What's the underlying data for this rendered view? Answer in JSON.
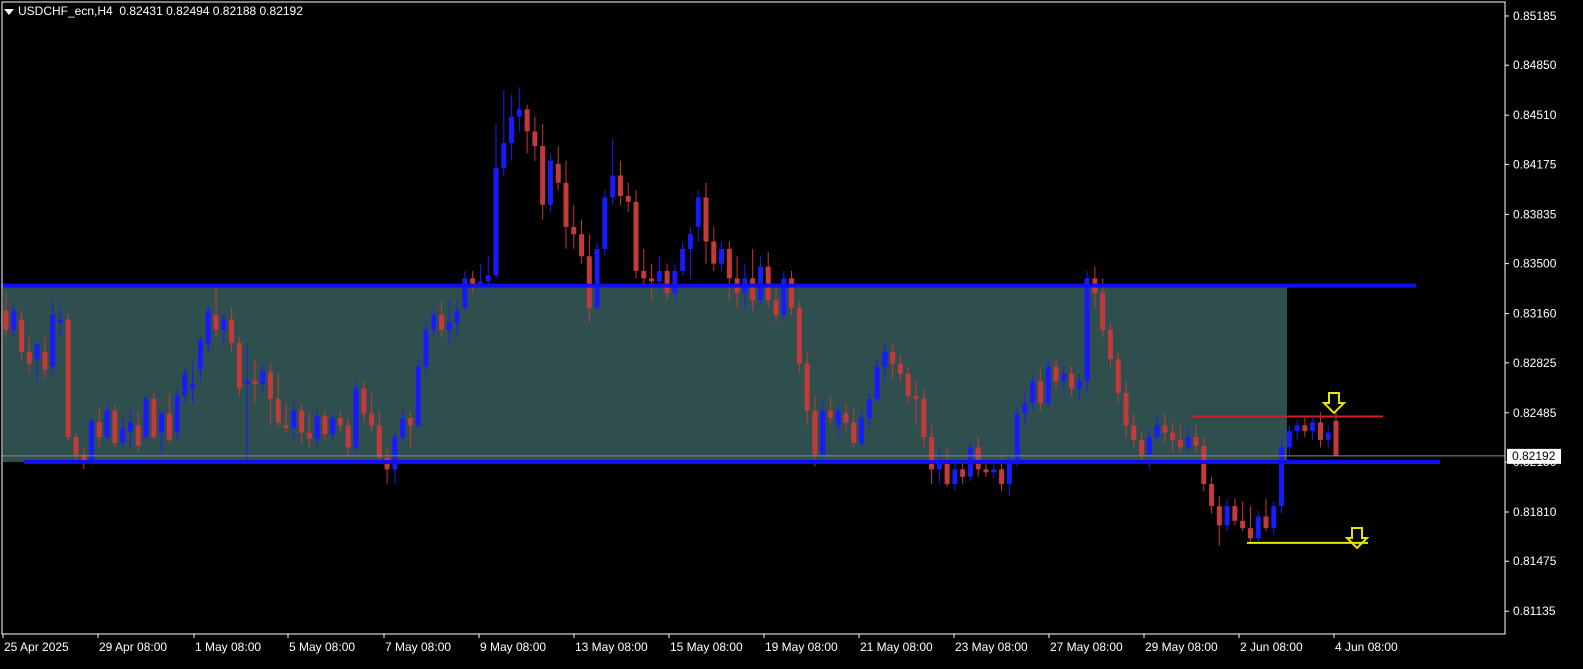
{
  "header": {
    "symbol": "USDCHF_ecn,H4",
    "ohlc": "0.82431 0.82494 0.82188 0.82192"
  },
  "colors": {
    "background": "#000000",
    "bull": "#1a1aff",
    "bear": "#c23a3a",
    "zone": "#2f4f4f",
    "zone_line": "#1010ee",
    "resistance_line": "#cc2222",
    "support_line": "#e6e600",
    "arrow": "#e6e600",
    "current_price_line": "#8a8a8a"
  },
  "icons": [
    "arrow-down-icon",
    "arrow-down-icon"
  ],
  "chart_data": {
    "type": "candlestick",
    "ylim": [
      0.8098,
      0.8528
    ],
    "y_ticks": [
      "0.85185",
      "0.84850",
      "0.84510",
      "0.84175",
      "0.83835",
      "0.83500",
      "0.83160",
      "0.82825",
      "0.82485",
      "0.82150",
      "0.81810",
      "0.81475",
      "0.81135"
    ],
    "x_ticks": [
      "25 Apr 2025",
      "29 Apr 08:00",
      "1 May 08:00",
      "5 May 08:00",
      "7 May 08:00",
      "9 May 08:00",
      "13 May 08:00",
      "15 May 08:00",
      "19 May 08:00",
      "21 May 08:00",
      "23 May 08:00",
      "27 May 08:00",
      "29 May 08:00",
      "2 Jun 08:00",
      "4 Jun 08:00"
    ],
    "current_price": "0.82192",
    "zone": {
      "top": 0.8335,
      "bottom": 0.8215
    },
    "resistance": 0.8246,
    "support": 0.816,
    "candles": [
      {
        "o": 0.8318,
        "h": 0.833,
        "l": 0.83,
        "c": 0.8305
      },
      {
        "o": 0.8305,
        "h": 0.8322,
        "l": 0.83,
        "c": 0.8318
      },
      {
        "o": 0.8312,
        "h": 0.8318,
        "l": 0.8285,
        "c": 0.829
      },
      {
        "o": 0.829,
        "h": 0.83,
        "l": 0.8275,
        "c": 0.8282
      },
      {
        "o": 0.8285,
        "h": 0.8298,
        "l": 0.827,
        "c": 0.8295
      },
      {
        "o": 0.829,
        "h": 0.83,
        "l": 0.8272,
        "c": 0.8278
      },
      {
        "o": 0.828,
        "h": 0.8325,
        "l": 0.8275,
        "c": 0.8315
      },
      {
        "o": 0.831,
        "h": 0.832,
        "l": 0.83,
        "c": 0.8312
      },
      {
        "o": 0.8312,
        "h": 0.8316,
        "l": 0.823,
        "c": 0.8232
      },
      {
        "o": 0.8232,
        "h": 0.8235,
        "l": 0.8215,
        "c": 0.822
      },
      {
        "o": 0.822,
        "h": 0.8225,
        "l": 0.821,
        "c": 0.8215
      },
      {
        "o": 0.8215,
        "h": 0.8245,
        "l": 0.8213,
        "c": 0.8243
      },
      {
        "o": 0.8242,
        "h": 0.8252,
        "l": 0.8225,
        "c": 0.8232
      },
      {
        "o": 0.8232,
        "h": 0.8255,
        "l": 0.8228,
        "c": 0.825
      },
      {
        "o": 0.825,
        "h": 0.8254,
        "l": 0.8225,
        "c": 0.8228
      },
      {
        "o": 0.8228,
        "h": 0.8245,
        "l": 0.8224,
        "c": 0.8238
      },
      {
        "o": 0.8236,
        "h": 0.825,
        "l": 0.8225,
        "c": 0.8242
      },
      {
        "o": 0.824,
        "h": 0.825,
        "l": 0.8222,
        "c": 0.8226
      },
      {
        "o": 0.8232,
        "h": 0.826,
        "l": 0.823,
        "c": 0.8258
      },
      {
        "o": 0.8258,
        "h": 0.8262,
        "l": 0.823,
        "c": 0.8232
      },
      {
        "o": 0.8235,
        "h": 0.825,
        "l": 0.8222,
        "c": 0.8248
      },
      {
        "o": 0.8248,
        "h": 0.8262,
        "l": 0.8228,
        "c": 0.823
      },
      {
        "o": 0.8235,
        "h": 0.8265,
        "l": 0.823,
        "c": 0.826
      },
      {
        "o": 0.826,
        "h": 0.828,
        "l": 0.8255,
        "c": 0.8275
      },
      {
        "o": 0.8265,
        "h": 0.8284,
        "l": 0.8255,
        "c": 0.8268
      },
      {
        "o": 0.8278,
        "h": 0.83,
        "l": 0.827,
        "c": 0.8298
      },
      {
        "o": 0.8295,
        "h": 0.8322,
        "l": 0.829,
        "c": 0.8318
      },
      {
        "o": 0.8315,
        "h": 0.8335,
        "l": 0.83,
        "c": 0.8305
      },
      {
        "o": 0.8305,
        "h": 0.8316,
        "l": 0.8295,
        "c": 0.8312
      },
      {
        "o": 0.8312,
        "h": 0.832,
        "l": 0.829,
        "c": 0.8296
      },
      {
        "o": 0.8296,
        "h": 0.83,
        "l": 0.826,
        "c": 0.8265
      },
      {
        "o": 0.8268,
        "h": 0.8294,
        "l": 0.8215,
        "c": 0.827
      },
      {
        "o": 0.827,
        "h": 0.8285,
        "l": 0.8255,
        "c": 0.8268
      },
      {
        "o": 0.8268,
        "h": 0.8282,
        "l": 0.8262,
        "c": 0.8277
      },
      {
        "o": 0.8276,
        "h": 0.8282,
        "l": 0.824,
        "c": 0.8258
      },
      {
        "o": 0.8258,
        "h": 0.8275,
        "l": 0.8238,
        "c": 0.8242
      },
      {
        "o": 0.824,
        "h": 0.8255,
        "l": 0.8235,
        "c": 0.8238
      },
      {
        "o": 0.8238,
        "h": 0.8256,
        "l": 0.823,
        "c": 0.825
      },
      {
        "o": 0.825,
        "h": 0.8255,
        "l": 0.8228,
        "c": 0.8235
      },
      {
        "o": 0.8235,
        "h": 0.8248,
        "l": 0.8225,
        "c": 0.8231
      },
      {
        "o": 0.8231,
        "h": 0.825,
        "l": 0.8226,
        "c": 0.8246
      },
      {
        "o": 0.8246,
        "h": 0.825,
        "l": 0.823,
        "c": 0.8234
      },
      {
        "o": 0.8234,
        "h": 0.8248,
        "l": 0.823,
        "c": 0.8245
      },
      {
        "o": 0.8245,
        "h": 0.825,
        "l": 0.8235,
        "c": 0.824
      },
      {
        "o": 0.824,
        "h": 0.8245,
        "l": 0.822,
        "c": 0.8225
      },
      {
        "o": 0.8225,
        "h": 0.827,
        "l": 0.8222,
        "c": 0.8265
      },
      {
        "o": 0.8265,
        "h": 0.827,
        "l": 0.8242,
        "c": 0.8248
      },
      {
        "o": 0.8248,
        "h": 0.8262,
        "l": 0.8235,
        "c": 0.824
      },
      {
        "o": 0.824,
        "h": 0.825,
        "l": 0.8215,
        "c": 0.8218
      },
      {
        "o": 0.8218,
        "h": 0.8225,
        "l": 0.82,
        "c": 0.821
      },
      {
        "o": 0.821,
        "h": 0.8235,
        "l": 0.82,
        "c": 0.8232
      },
      {
        "o": 0.8232,
        "h": 0.825,
        "l": 0.8228,
        "c": 0.8245
      },
      {
        "o": 0.8245,
        "h": 0.825,
        "l": 0.8225,
        "c": 0.824
      },
      {
        "o": 0.824,
        "h": 0.8285,
        "l": 0.8238,
        "c": 0.828
      },
      {
        "o": 0.828,
        "h": 0.831,
        "l": 0.8275,
        "c": 0.8305
      },
      {
        "o": 0.8305,
        "h": 0.832,
        "l": 0.83,
        "c": 0.8315
      },
      {
        "o": 0.8315,
        "h": 0.8325,
        "l": 0.83,
        "c": 0.8305
      },
      {
        "o": 0.8305,
        "h": 0.8325,
        "l": 0.8295,
        "c": 0.831
      },
      {
        "o": 0.831,
        "h": 0.8325,
        "l": 0.83,
        "c": 0.8318
      },
      {
        "o": 0.832,
        "h": 0.8345,
        "l": 0.8318,
        "c": 0.834
      },
      {
        "o": 0.834,
        "h": 0.8345,
        "l": 0.833,
        "c": 0.8335
      },
      {
        "o": 0.8335,
        "h": 0.835,
        "l": 0.8332,
        "c": 0.8338
      },
      {
        "o": 0.8338,
        "h": 0.8355,
        "l": 0.8335,
        "c": 0.8342
      },
      {
        "o": 0.8342,
        "h": 0.8445,
        "l": 0.834,
        "c": 0.8415
      },
      {
        "o": 0.8415,
        "h": 0.8468,
        "l": 0.841,
        "c": 0.8432
      },
      {
        "o": 0.8432,
        "h": 0.8465,
        "l": 0.842,
        "c": 0.845
      },
      {
        "o": 0.845,
        "h": 0.847,
        "l": 0.844,
        "c": 0.8455
      },
      {
        "o": 0.8455,
        "h": 0.8458,
        "l": 0.8425,
        "c": 0.844
      },
      {
        "o": 0.844,
        "h": 0.845,
        "l": 0.842,
        "c": 0.843
      },
      {
        "o": 0.843,
        "h": 0.8445,
        "l": 0.838,
        "c": 0.839
      },
      {
        "o": 0.839,
        "h": 0.8425,
        "l": 0.8385,
        "c": 0.842
      },
      {
        "o": 0.8418,
        "h": 0.843,
        "l": 0.84,
        "c": 0.8405
      },
      {
        "o": 0.8405,
        "h": 0.842,
        "l": 0.836,
        "c": 0.8375
      },
      {
        "o": 0.8375,
        "h": 0.839,
        "l": 0.836,
        "c": 0.837
      },
      {
        "o": 0.837,
        "h": 0.838,
        "l": 0.835,
        "c": 0.8355
      },
      {
        "o": 0.8355,
        "h": 0.837,
        "l": 0.831,
        "c": 0.832
      },
      {
        "o": 0.832,
        "h": 0.8365,
        "l": 0.8318,
        "c": 0.836
      },
      {
        "o": 0.836,
        "h": 0.84,
        "l": 0.8355,
        "c": 0.8395
      },
      {
        "o": 0.8395,
        "h": 0.8435,
        "l": 0.839,
        "c": 0.841
      },
      {
        "o": 0.841,
        "h": 0.842,
        "l": 0.839,
        "c": 0.8396
      },
      {
        "o": 0.8396,
        "h": 0.8405,
        "l": 0.8385,
        "c": 0.8392
      },
      {
        "o": 0.8392,
        "h": 0.84,
        "l": 0.834,
        "c": 0.8345
      },
      {
        "o": 0.8345,
        "h": 0.836,
        "l": 0.8335,
        "c": 0.834
      },
      {
        "o": 0.834,
        "h": 0.835,
        "l": 0.8325,
        "c": 0.8338
      },
      {
        "o": 0.8338,
        "h": 0.8355,
        "l": 0.833,
        "c": 0.8345
      },
      {
        "o": 0.8345,
        "h": 0.835,
        "l": 0.8325,
        "c": 0.833
      },
      {
        "o": 0.833,
        "h": 0.835,
        "l": 0.8325,
        "c": 0.8345
      },
      {
        "o": 0.8345,
        "h": 0.8365,
        "l": 0.8342,
        "c": 0.836
      },
      {
        "o": 0.836,
        "h": 0.8375,
        "l": 0.834,
        "c": 0.837
      },
      {
        "o": 0.8375,
        "h": 0.84,
        "l": 0.8365,
        "c": 0.8395
      },
      {
        "o": 0.8395,
        "h": 0.8405,
        "l": 0.835,
        "c": 0.8365
      },
      {
        "o": 0.8365,
        "h": 0.8375,
        "l": 0.8345,
        "c": 0.835
      },
      {
        "o": 0.835,
        "h": 0.8365,
        "l": 0.8345,
        "c": 0.836
      },
      {
        "o": 0.836,
        "h": 0.8365,
        "l": 0.8325,
        "c": 0.834
      },
      {
        "o": 0.834,
        "h": 0.8355,
        "l": 0.832,
        "c": 0.833
      },
      {
        "o": 0.833,
        "h": 0.835,
        "l": 0.832,
        "c": 0.834
      },
      {
        "o": 0.834,
        "h": 0.836,
        "l": 0.8318,
        "c": 0.8325
      },
      {
        "o": 0.8325,
        "h": 0.8355,
        "l": 0.8322,
        "c": 0.8348
      },
      {
        "o": 0.8348,
        "h": 0.8358,
        "l": 0.832,
        "c": 0.8325
      },
      {
        "o": 0.8325,
        "h": 0.8335,
        "l": 0.831,
        "c": 0.8315
      },
      {
        "o": 0.8315,
        "h": 0.8345,
        "l": 0.8312,
        "c": 0.834
      },
      {
        "o": 0.834,
        "h": 0.8345,
        "l": 0.8315,
        "c": 0.832
      },
      {
        "o": 0.832,
        "h": 0.8325,
        "l": 0.8275,
        "c": 0.8282
      },
      {
        "o": 0.8282,
        "h": 0.829,
        "l": 0.824,
        "c": 0.825
      },
      {
        "o": 0.825,
        "h": 0.826,
        "l": 0.8212,
        "c": 0.822
      },
      {
        "o": 0.822,
        "h": 0.8258,
        "l": 0.8218,
        "c": 0.825
      },
      {
        "o": 0.825,
        "h": 0.826,
        "l": 0.824,
        "c": 0.8245
      },
      {
        "o": 0.824,
        "h": 0.8255,
        "l": 0.8232,
        "c": 0.825
      },
      {
        "o": 0.8248,
        "h": 0.8255,
        "l": 0.8235,
        "c": 0.8242
      },
      {
        "o": 0.8242,
        "h": 0.8252,
        "l": 0.8225,
        "c": 0.8228
      },
      {
        "o": 0.8228,
        "h": 0.825,
        "l": 0.8225,
        "c": 0.8245
      },
      {
        "o": 0.8245,
        "h": 0.8262,
        "l": 0.8238,
        "c": 0.8258
      },
      {
        "o": 0.8258,
        "h": 0.8285,
        "l": 0.8255,
        "c": 0.828
      },
      {
        "o": 0.828,
        "h": 0.8295,
        "l": 0.827,
        "c": 0.829
      },
      {
        "o": 0.829,
        "h": 0.8295,
        "l": 0.8272,
        "c": 0.8282
      },
      {
        "o": 0.8282,
        "h": 0.8288,
        "l": 0.827,
        "c": 0.8275
      },
      {
        "o": 0.8275,
        "h": 0.828,
        "l": 0.8255,
        "c": 0.826
      },
      {
        "o": 0.826,
        "h": 0.827,
        "l": 0.824,
        "c": 0.8258
      },
      {
        "o": 0.8258,
        "h": 0.8265,
        "l": 0.8225,
        "c": 0.8232
      },
      {
        "o": 0.8232,
        "h": 0.824,
        "l": 0.82,
        "c": 0.821
      },
      {
        "o": 0.821,
        "h": 0.8225,
        "l": 0.82,
        "c": 0.8215
      },
      {
        "o": 0.8215,
        "h": 0.8225,
        "l": 0.8198,
        "c": 0.82
      },
      {
        "o": 0.82,
        "h": 0.8215,
        "l": 0.8196,
        "c": 0.821
      },
      {
        "o": 0.821,
        "h": 0.8218,
        "l": 0.82,
        "c": 0.8205
      },
      {
        "o": 0.8205,
        "h": 0.8228,
        "l": 0.8202,
        "c": 0.8225
      },
      {
        "o": 0.8225,
        "h": 0.8232,
        "l": 0.8205,
        "c": 0.821
      },
      {
        "o": 0.821,
        "h": 0.8215,
        "l": 0.8205,
        "c": 0.8208
      },
      {
        "o": 0.8208,
        "h": 0.8215,
        "l": 0.8204,
        "c": 0.821
      },
      {
        "o": 0.821,
        "h": 0.822,
        "l": 0.8195,
        "c": 0.82
      },
      {
        "o": 0.82,
        "h": 0.822,
        "l": 0.8192,
        "c": 0.8215
      },
      {
        "o": 0.8215,
        "h": 0.8252,
        "l": 0.8212,
        "c": 0.8248
      },
      {
        "o": 0.8248,
        "h": 0.8262,
        "l": 0.824,
        "c": 0.8255
      },
      {
        "o": 0.8255,
        "h": 0.8275,
        "l": 0.825,
        "c": 0.827
      },
      {
        "o": 0.827,
        "h": 0.8278,
        "l": 0.825,
        "c": 0.8255
      },
      {
        "o": 0.8255,
        "h": 0.8285,
        "l": 0.8252,
        "c": 0.828
      },
      {
        "o": 0.828,
        "h": 0.8285,
        "l": 0.8265,
        "c": 0.827
      },
      {
        "o": 0.827,
        "h": 0.828,
        "l": 0.8262,
        "c": 0.8275
      },
      {
        "o": 0.8275,
        "h": 0.828,
        "l": 0.826,
        "c": 0.8265
      },
      {
        "o": 0.8265,
        "h": 0.8275,
        "l": 0.8258,
        "c": 0.827
      },
      {
        "o": 0.827,
        "h": 0.8345,
        "l": 0.8262,
        "c": 0.834
      },
      {
        "o": 0.834,
        "h": 0.8348,
        "l": 0.832,
        "c": 0.833
      },
      {
        "o": 0.833,
        "h": 0.834,
        "l": 0.83,
        "c": 0.8305
      },
      {
        "o": 0.8305,
        "h": 0.831,
        "l": 0.828,
        "c": 0.8285
      },
      {
        "o": 0.8285,
        "h": 0.829,
        "l": 0.8255,
        "c": 0.8262
      },
      {
        "o": 0.8262,
        "h": 0.827,
        "l": 0.8232,
        "c": 0.824
      },
      {
        "o": 0.824,
        "h": 0.8248,
        "l": 0.8225,
        "c": 0.823
      },
      {
        "o": 0.823,
        "h": 0.8235,
        "l": 0.8215,
        "c": 0.822
      },
      {
        "o": 0.822,
        "h": 0.8238,
        "l": 0.821,
        "c": 0.8232
      },
      {
        "o": 0.8232,
        "h": 0.8248,
        "l": 0.8228,
        "c": 0.824
      },
      {
        "o": 0.824,
        "h": 0.8248,
        "l": 0.8228,
        "c": 0.8235
      },
      {
        "o": 0.8235,
        "h": 0.8242,
        "l": 0.8222,
        "c": 0.823
      },
      {
        "o": 0.823,
        "h": 0.824,
        "l": 0.8222,
        "c": 0.8225
      },
      {
        "o": 0.8225,
        "h": 0.8238,
        "l": 0.8222,
        "c": 0.8232
      },
      {
        "o": 0.8232,
        "h": 0.824,
        "l": 0.8222,
        "c": 0.8226
      },
      {
        "o": 0.8226,
        "h": 0.8232,
        "l": 0.8195,
        "c": 0.82
      },
      {
        "o": 0.82,
        "h": 0.8205,
        "l": 0.818,
        "c": 0.8185
      },
      {
        "o": 0.8185,
        "h": 0.8192,
        "l": 0.8158,
        "c": 0.8172
      },
      {
        "o": 0.8172,
        "h": 0.819,
        "l": 0.8168,
        "c": 0.8185
      },
      {
        "o": 0.8185,
        "h": 0.819,
        "l": 0.8172,
        "c": 0.8175
      },
      {
        "o": 0.8175,
        "h": 0.8188,
        "l": 0.8168,
        "c": 0.817
      },
      {
        "o": 0.817,
        "h": 0.8185,
        "l": 0.816,
        "c": 0.8163
      },
      {
        "o": 0.8163,
        "h": 0.8182,
        "l": 0.816,
        "c": 0.8178
      },
      {
        "o": 0.8178,
        "h": 0.819,
        "l": 0.8168,
        "c": 0.817
      },
      {
        "o": 0.817,
        "h": 0.8188,
        "l": 0.8166,
        "c": 0.8185
      },
      {
        "o": 0.8185,
        "h": 0.8232,
        "l": 0.818,
        "c": 0.8225
      },
      {
        "o": 0.8225,
        "h": 0.824,
        "l": 0.822,
        "c": 0.8236
      },
      {
        "o": 0.8236,
        "h": 0.8244,
        "l": 0.823,
        "c": 0.824
      },
      {
        "o": 0.824,
        "h": 0.8245,
        "l": 0.8232,
        "c": 0.8236
      },
      {
        "o": 0.8236,
        "h": 0.8245,
        "l": 0.823,
        "c": 0.8242
      },
      {
        "o": 0.8242,
        "h": 0.8249,
        "l": 0.8225,
        "c": 0.823
      },
      {
        "o": 0.823,
        "h": 0.824,
        "l": 0.8225,
        "c": 0.8235
      },
      {
        "o": 0.8243,
        "h": 0.8249,
        "l": 0.8219,
        "c": 0.8219
      }
    ]
  }
}
